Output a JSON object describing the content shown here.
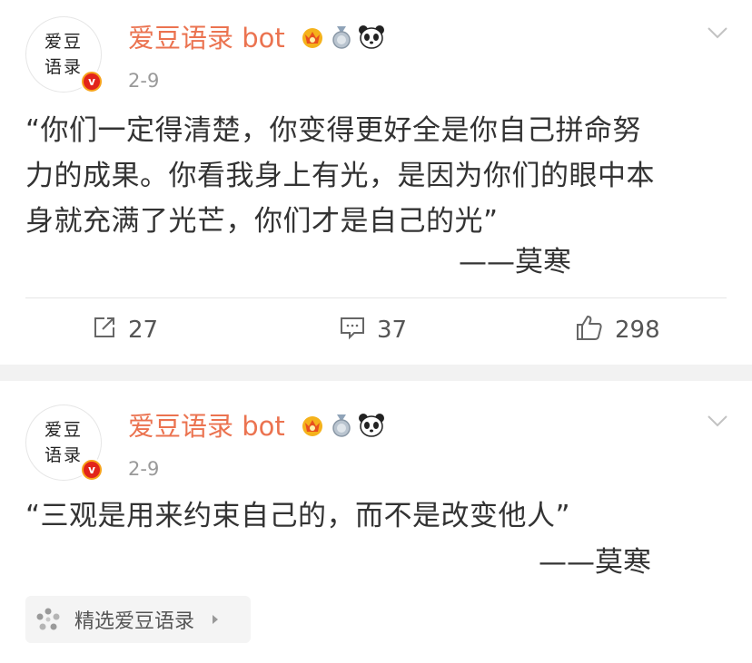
{
  "posts": [
    {
      "avatar_text": [
        "爱豆",
        "语录"
      ],
      "verified_mark": "v",
      "username": "爱豆语录 bot",
      "badges": [
        "crown-badge-icon",
        "medal-badge-icon",
        "panda-icon"
      ],
      "time": "2-9",
      "content_lines": [
        "“你们一定得清楚，你变得更好全是你自己拼命努",
        "力的成果。你看我身上有光，是因为你们的眼中本",
        "身就充满了光芒，你们才是自己的光”"
      ],
      "signature": "——莫寒",
      "repost_count": "27",
      "comment_count": "37",
      "like_count": "298"
    },
    {
      "avatar_text": [
        "爱豆",
        "语录"
      ],
      "verified_mark": "v",
      "username": "爱豆语录 bot",
      "badges": [
        "crown-badge-icon",
        "medal-badge-icon",
        "panda-icon"
      ],
      "time": "2-9",
      "content_lines": [
        "“三观是用来约束自己的，而不是改变他人”"
      ],
      "signature": "——莫寒",
      "topic_tag": "精选爱豆语录"
    }
  ],
  "colors": {
    "username": "#eb7350",
    "verified_badge": "#f7a21b",
    "separator": "#f2f2f2"
  }
}
